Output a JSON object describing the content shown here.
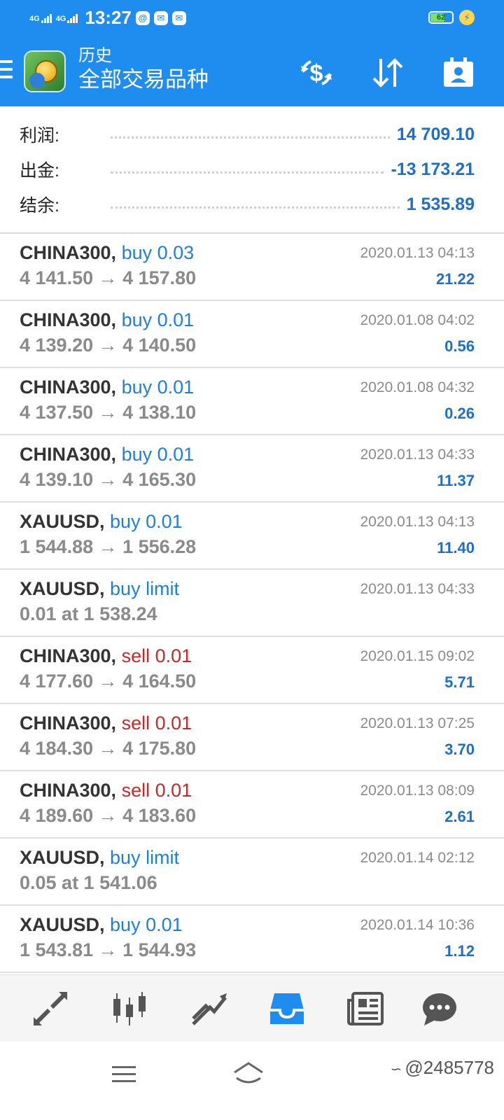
{
  "status_bar": {
    "net1": "4G",
    "net2": "4G",
    "time": "13:27",
    "battery": "62"
  },
  "header": {
    "subtitle": "历史",
    "title": "全部交易品种"
  },
  "summary": [
    {
      "label": "利润:",
      "value": "14 709.10"
    },
    {
      "label": "出金:",
      "value": "-13 173.21"
    },
    {
      "label": "结余:",
      "value": "1 535.89"
    }
  ],
  "trades": [
    {
      "symbol": "CHINA300,",
      "type": "buy 0.03",
      "side": "buy",
      "prices": "4 141.50 → 4 157.80",
      "date": "2020.01.13 04:13",
      "profit": "21.22"
    },
    {
      "symbol": "CHINA300,",
      "type": "buy 0.01",
      "side": "buy",
      "prices": "4 139.20 → 4 140.50",
      "date": "2020.01.08 04:02",
      "profit": "0.56"
    },
    {
      "symbol": "CHINA300,",
      "type": "buy 0.01",
      "side": "buy",
      "prices": "4 137.50 → 4 138.10",
      "date": "2020.01.08 04:32",
      "profit": "0.26"
    },
    {
      "symbol": "CHINA300,",
      "type": "buy 0.01",
      "side": "buy",
      "prices": "4 139.10 → 4 165.30",
      "date": "2020.01.13 04:33",
      "profit": "11.37"
    },
    {
      "symbol": "XAUUSD,",
      "type": "buy 0.01",
      "side": "buy",
      "prices": "1 544.88 → 1 556.28",
      "date": "2020.01.13 04:13",
      "profit": "11.40"
    },
    {
      "symbol": "XAUUSD,",
      "type": "buy limit",
      "side": "buy",
      "prices": "0.01 at 1 538.24",
      "date": "2020.01.13 04:33",
      "profit": ""
    },
    {
      "symbol": "CHINA300,",
      "type": "sell 0.01",
      "side": "sell",
      "prices": "4 177.60 → 4 164.50",
      "date": "2020.01.15 09:02",
      "profit": "5.71"
    },
    {
      "symbol": "CHINA300,",
      "type": "sell 0.01",
      "side": "sell",
      "prices": "4 184.30 → 4 175.80",
      "date": "2020.01.13 07:25",
      "profit": "3.70"
    },
    {
      "symbol": "CHINA300,",
      "type": "sell 0.01",
      "side": "sell",
      "prices": "4 189.60 → 4 183.60",
      "date": "2020.01.13 08:09",
      "profit": "2.61"
    },
    {
      "symbol": "XAUUSD,",
      "type": "buy limit",
      "side": "buy",
      "prices": "0.05 at 1 541.06",
      "date": "2020.01.14 02:12",
      "profit": ""
    },
    {
      "symbol": "XAUUSD,",
      "type": "buy 0.01",
      "side": "buy",
      "prices": "1 543.81 → 1 544.93",
      "date": "2020.01.14 10:36",
      "profit": "1.12"
    }
  ],
  "bottom_nav": [
    {
      "icon": "quotes-icon",
      "active": false
    },
    {
      "icon": "chart-icon",
      "active": false
    },
    {
      "icon": "trade-icon",
      "active": false
    },
    {
      "icon": "history-icon",
      "active": true
    },
    {
      "icon": "news-icon",
      "active": false
    },
    {
      "icon": "chat-icon",
      "active": false
    }
  ],
  "watermark": "@2485778",
  "colors": {
    "primary": "#1f8cef",
    "profit": "#1e6fc7",
    "buy": "#1f7fd6",
    "sell": "#c62828",
    "muted": "#8a8a8a",
    "nav_active": "#1f8cef",
    "nav_inactive": "#555555"
  }
}
